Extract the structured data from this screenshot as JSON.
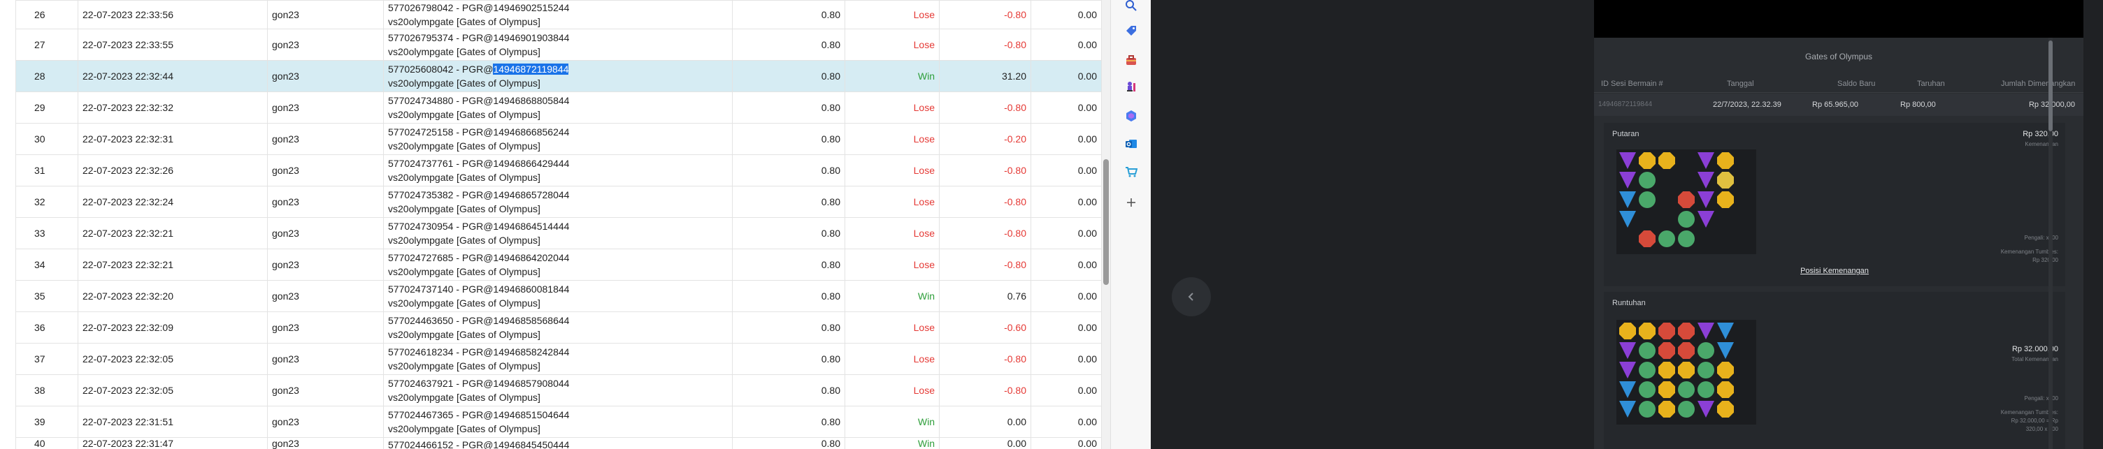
{
  "table": {
    "rows": [
      {
        "no": "26",
        "date": "22-07-2023 22:33:56",
        "user": "gon23",
        "desc1": "577026798042 - PGR@14946902515244",
        "desc2": "vs20olympgate [Gates of Olympus]",
        "bet": "0.80",
        "result": "Lose",
        "win": "-0.80",
        "balance": "0.00"
      },
      {
        "no": "27",
        "date": "22-07-2023 22:33:55",
        "user": "gon23",
        "desc1": "577026795374 - PGR@14946901903844",
        "desc2": "vs20olympgate [Gates of Olympus]",
        "bet": "0.80",
        "result": "Lose",
        "win": "-0.80",
        "balance": "0.00"
      },
      {
        "no": "28",
        "date": "22-07-2023 22:32:44",
        "user": "gon23",
        "desc1": "577025608042 - PGR@",
        "desc1_highlight": "14946872119844",
        "desc2": "vs20olympgate [Gates of Olympus]",
        "bet": "0.80",
        "result": "Win",
        "win": "31.20",
        "balance": "0.00"
      },
      {
        "no": "29",
        "date": "22-07-2023 22:32:32",
        "user": "gon23",
        "desc1": "577024734880 - PGR@14946868805844",
        "desc2": "vs20olympgate [Gates of Olympus]",
        "bet": "0.80",
        "result": "Lose",
        "win": "-0.80",
        "balance": "0.00"
      },
      {
        "no": "30",
        "date": "22-07-2023 22:32:31",
        "user": "gon23",
        "desc1": "577024725158 - PGR@14946866856244",
        "desc2": "vs20olympgate [Gates of Olympus]",
        "bet": "0.80",
        "result": "Lose",
        "win": "-0.20",
        "balance": "0.00"
      },
      {
        "no": "31",
        "date": "22-07-2023 22:32:26",
        "user": "gon23",
        "desc1": "577024737761 - PGR@14946866429444",
        "desc2": "vs20olympgate [Gates of Olympus]",
        "bet": "0.80",
        "result": "Lose",
        "win": "-0.80",
        "balance": "0.00"
      },
      {
        "no": "32",
        "date": "22-07-2023 22:32:24",
        "user": "gon23",
        "desc1": "577024735382 - PGR@14946865728044",
        "desc2": "vs20olympgate [Gates of Olympus]",
        "bet": "0.80",
        "result": "Lose",
        "win": "-0.80",
        "balance": "0.00"
      },
      {
        "no": "33",
        "date": "22-07-2023 22:32:21",
        "user": "gon23",
        "desc1": "577024730954 - PGR@14946864514444",
        "desc2": "vs20olympgate [Gates of Olympus]",
        "bet": "0.80",
        "result": "Lose",
        "win": "-0.80",
        "balance": "0.00"
      },
      {
        "no": "34",
        "date": "22-07-2023 22:32:21",
        "user": "gon23",
        "desc1": "577024727685 - PGR@14946864202044",
        "desc2": "vs20olympgate [Gates of Olympus]",
        "bet": "0.80",
        "result": "Lose",
        "win": "-0.80",
        "balance": "0.00"
      },
      {
        "no": "35",
        "date": "22-07-2023 22:32:20",
        "user": "gon23",
        "desc1": "577024737140 - PGR@14946860081844",
        "desc2": "vs20olympgate [Gates of Olympus]",
        "bet": "0.80",
        "result": "Win",
        "win": "0.76",
        "balance": "0.00"
      },
      {
        "no": "36",
        "date": "22-07-2023 22:32:09",
        "user": "gon23",
        "desc1": "577024463650 - PGR@14946858568644",
        "desc2": "vs20olympgate [Gates of Olympus]",
        "bet": "0.80",
        "result": "Lose",
        "win": "-0.60",
        "balance": "0.00"
      },
      {
        "no": "37",
        "date": "22-07-2023 22:32:05",
        "user": "gon23",
        "desc1": "577024618234 - PGR@14946858242844",
        "desc2": "vs20olympgate [Gates of Olympus]",
        "bet": "0.80",
        "result": "Lose",
        "win": "-0.80",
        "balance": "0.00"
      },
      {
        "no": "38",
        "date": "22-07-2023 22:32:05",
        "user": "gon23",
        "desc1": "577024637921 - PGR@14946857908044",
        "desc2": "vs20olympgate [Gates of Olympus]",
        "bet": "0.80",
        "result": "Lose",
        "win": "-0.80",
        "balance": "0.00"
      },
      {
        "no": "39",
        "date": "22-07-2023 22:31:51",
        "user": "gon23",
        "desc1": "577024467365 - PGR@14946851504644",
        "desc2": "vs20olympgate [Gates of Olympus]",
        "bet": "0.80",
        "result": "Win",
        "win": "0.00",
        "balance": "0.00"
      },
      {
        "no": "40",
        "date": "22-07-2023 22:31:47",
        "user": "gon23",
        "desc1": "577024466152 - PGR@14946845450444",
        "desc2": "",
        "bet": "0.80",
        "result": "Win",
        "win": "0.00",
        "balance": "0.00"
      }
    ],
    "selected_row": 2
  },
  "toolbar": {
    "icons": [
      "search-icon",
      "tag-icon",
      "toolbox-icon",
      "chess-icon",
      "copilot-icon",
      "outlook-icon",
      "shopping-cart-icon",
      "plus-icon"
    ]
  },
  "game": {
    "title": "Gates of Olympus",
    "headers": {
      "id": "ID Sesi Bermain #",
      "date": "Tanggal",
      "balance": "Saldo Baru",
      "bet": "Taruhan",
      "win": "Jumlah Dimenangkan"
    },
    "values": {
      "id": "14946872119844",
      "date": "22/7/2023, 22.32.39",
      "balance": "Rp 65.965,00",
      "bet": "Rp 800,00",
      "win": "Rp 32.000,00"
    },
    "spin": {
      "title": "Putaran",
      "amount": "Rp 320,00",
      "amount_sub": "Kemenangan",
      "multiplier_label": "Pengali: x100",
      "total_label": "Kemenangan Tumbles:",
      "total_value": "Rp 320,00",
      "link": "Posisi Kemenangan"
    },
    "tumble": {
      "title": "Runtuhan",
      "amount": "Rp 32.000,00",
      "amount_sub": "Total Kemenangan",
      "multiplier_label": "Pengali: x100",
      "total_label": "Kemenangan Tumbles:",
      "total_value": "Rp 32.000,00 = Rp",
      "total_extra": "320,00 x 100"
    }
  },
  "colors": {
    "lose": "#e53935",
    "win": "#2e9e3a",
    "selected": "#d6ecf3",
    "highlight": "#1a73e8",
    "panel": "#2a2d31"
  }
}
